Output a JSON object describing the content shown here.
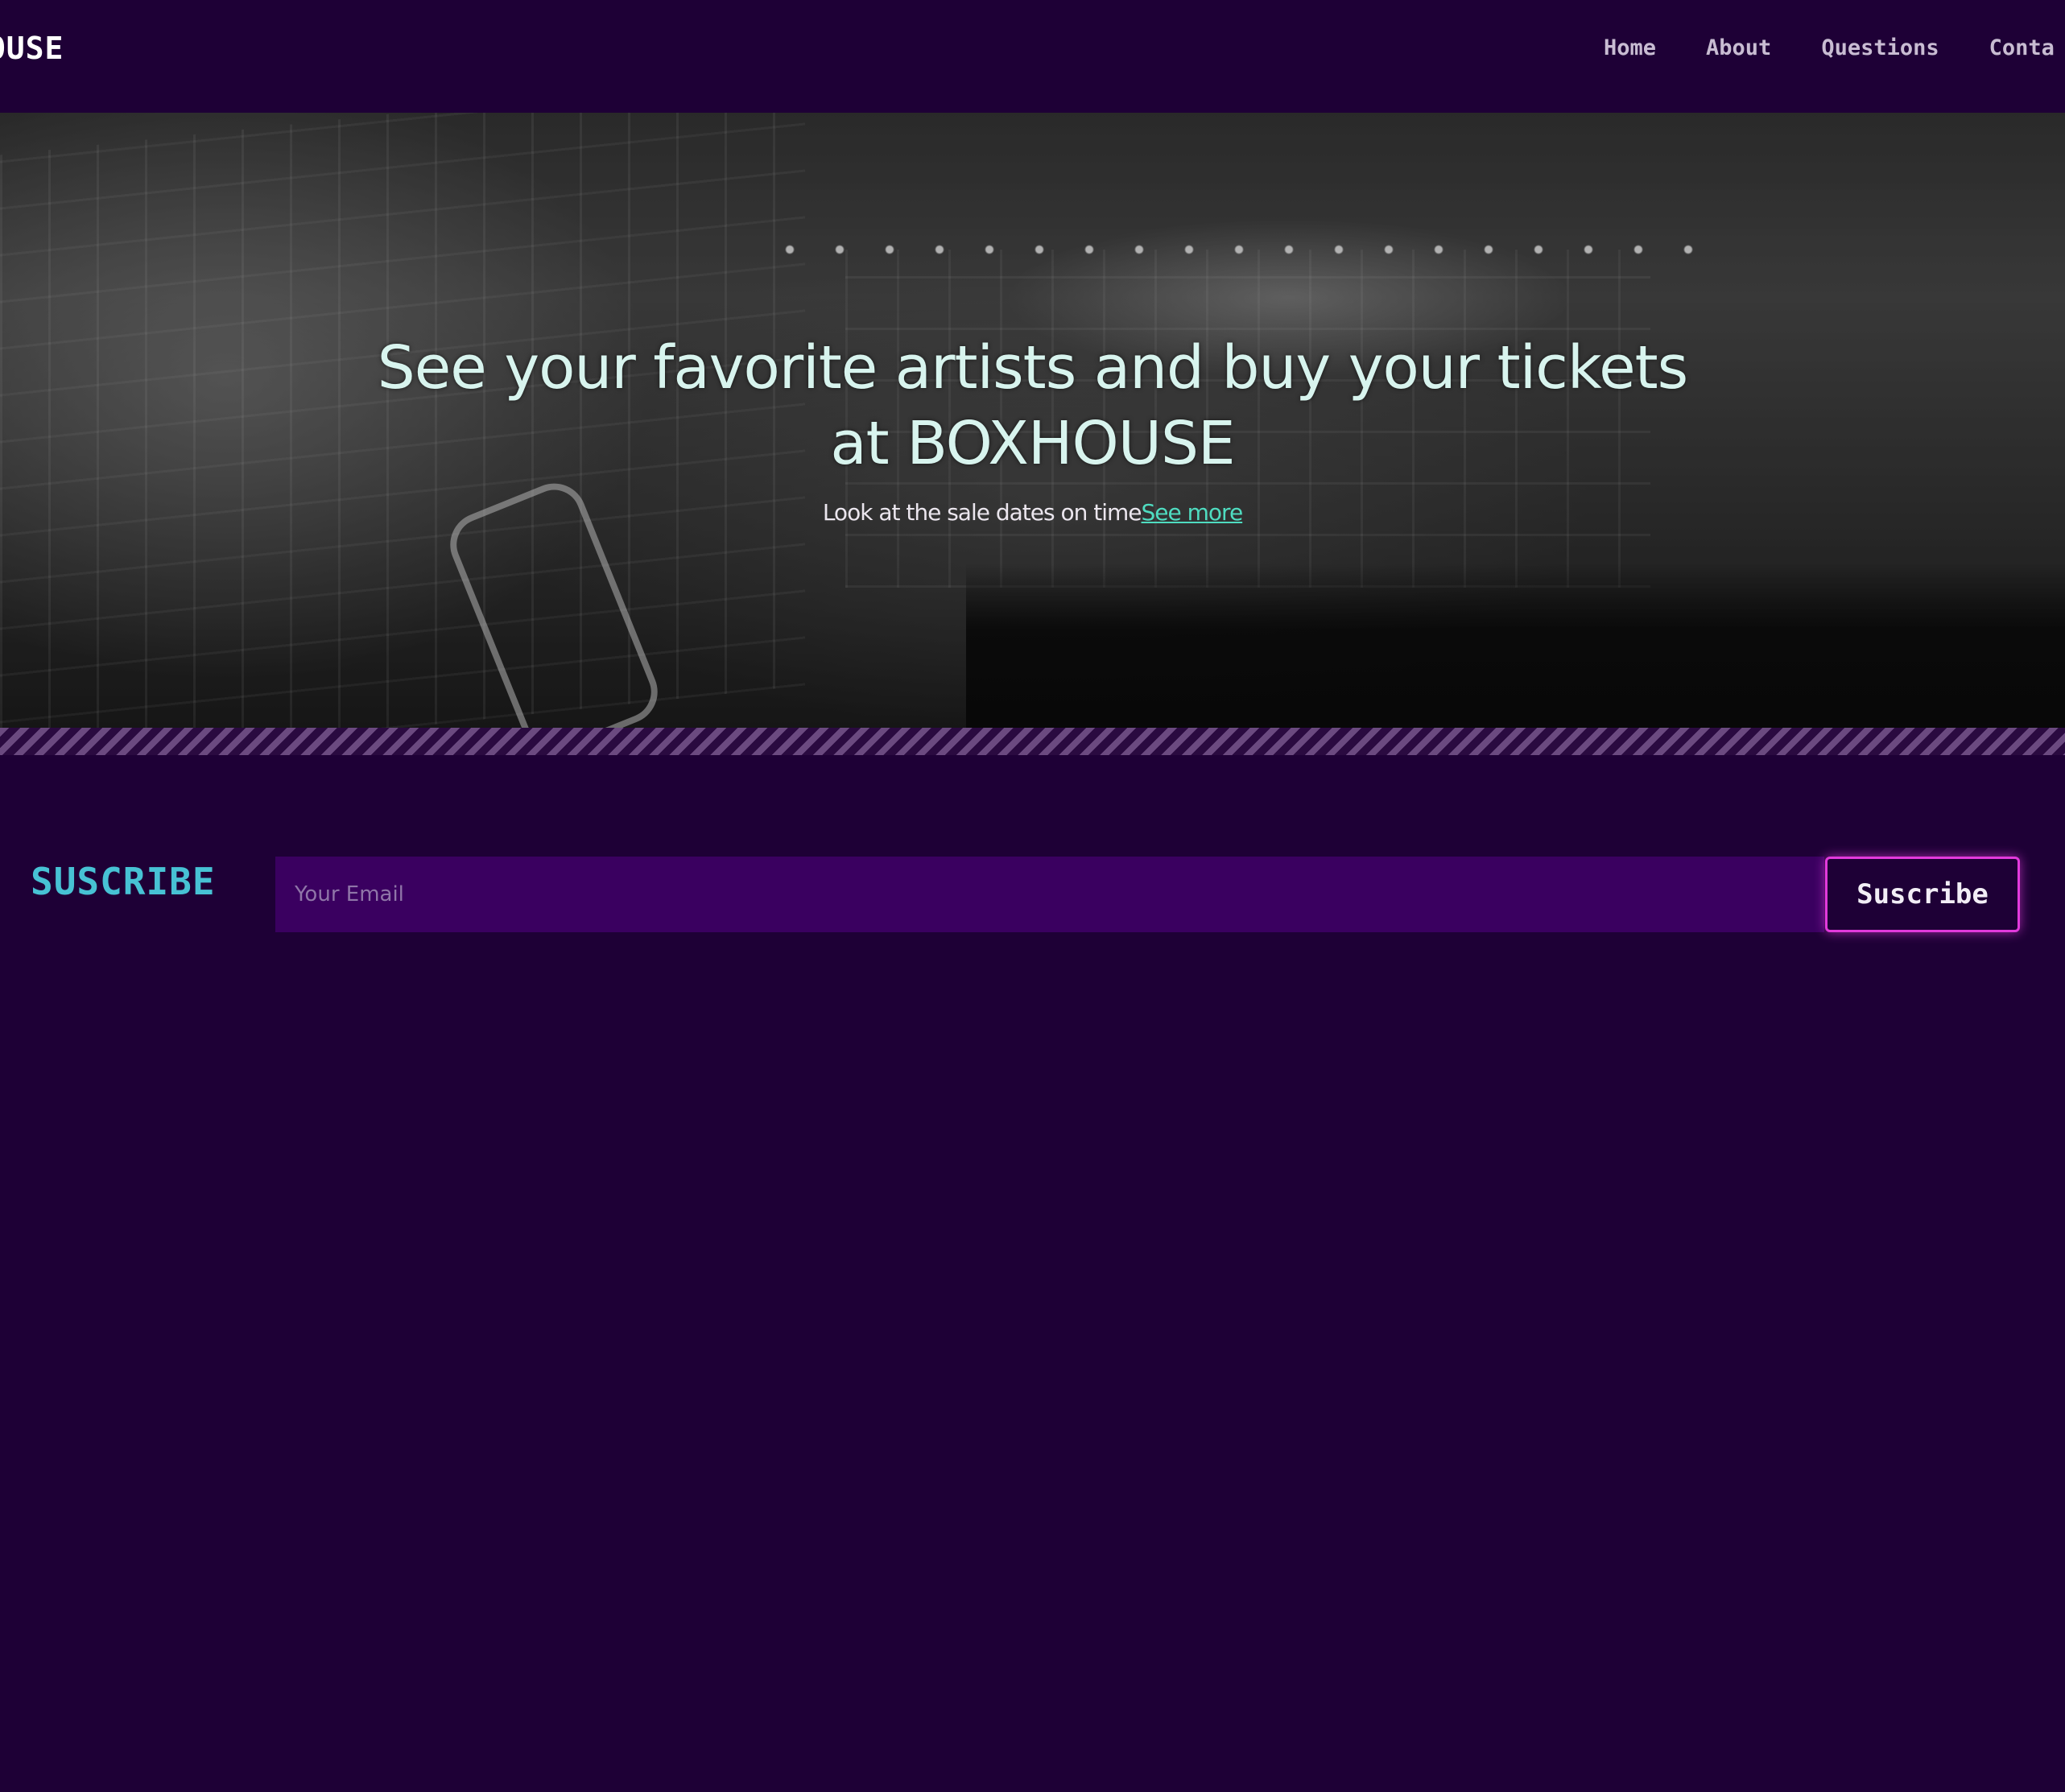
{
  "header": {
    "brand": "HOUSE",
    "nav": [
      "Home",
      "About",
      "Questions",
      "Conta"
    ]
  },
  "hero": {
    "title": "See your favorite artists and buy your tickets at BOXHOUSE",
    "subtitle": "Look at the sale dates on time",
    "link_label": "See more"
  },
  "subscribe": {
    "label": "SUSCRIBE",
    "placeholder": "Your Email",
    "button_label": "Suscribe"
  },
  "colors": {
    "background": "#1e0036",
    "accent_cyan": "#47c2d4",
    "link_teal": "#4fdcc0",
    "input_bg": "#3a0060",
    "button_border": "#e23adc"
  }
}
